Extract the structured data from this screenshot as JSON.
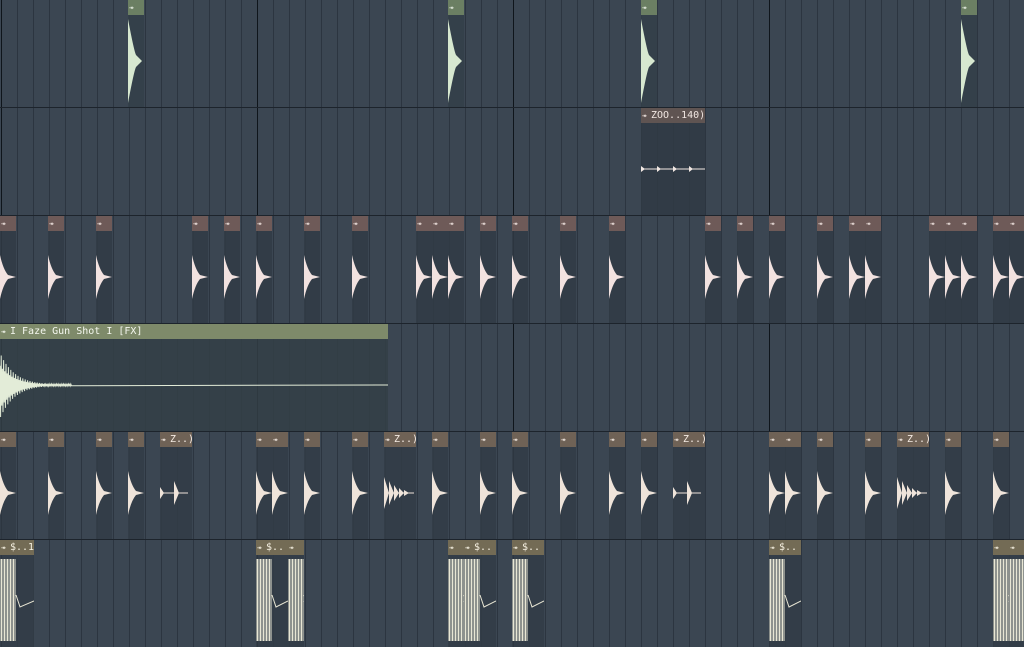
{
  "playlist": {
    "theme": {
      "background": "#3b4652",
      "bar_line": "#0f151b",
      "beat_line": "#2c3540"
    },
    "tracks": [
      {
        "name_visible": "",
        "header_color": "#6b7f63",
        "header_text": "#e8efe4",
        "body_color": "#343f49",
        "wave_color": "#d7e8d0",
        "clips": [
          {
            "start": 128,
            "width": 16,
            "label": "",
            "wave": "spike"
          },
          {
            "start": 448,
            "width": 16,
            "label": "",
            "wave": "spike"
          },
          {
            "start": 641,
            "width": 16,
            "label": "",
            "wave": "spike"
          },
          {
            "start": 961,
            "width": 16,
            "label": "",
            "wave": "spike"
          }
        ]
      },
      {
        "header_color": "#5f5452",
        "header_text": "#f0e6e2",
        "body_color": "#303a44",
        "wave_color": "#f3e9e4",
        "clips": [
          {
            "start": 641,
            "width": 64,
            "label": "ZOO..140)",
            "wave": "taps"
          }
        ]
      },
      {
        "header_color": "#6e5a58",
        "header_text": "#f1e5e1",
        "body_color": "#313b45",
        "wave_color": "#f2e2e0",
        "clips": [
          {
            "start": 0,
            "width": 16,
            "label": ""
          },
          {
            "start": 48,
            "width": 16,
            "label": ""
          },
          {
            "start": 96,
            "width": 16,
            "label": ""
          },
          {
            "start": 192,
            "width": 16,
            "label": ""
          },
          {
            "start": 224,
            "width": 16,
            "label": ""
          },
          {
            "start": 256,
            "width": 16,
            "label": ""
          },
          {
            "start": 304,
            "width": 16,
            "label": ""
          },
          {
            "start": 352,
            "width": 16,
            "label": ""
          },
          {
            "start": 416,
            "width": 16,
            "label": ""
          },
          {
            "start": 432,
            "width": 16,
            "label": ""
          },
          {
            "start": 448,
            "width": 16,
            "label": ""
          },
          {
            "start": 480,
            "width": 16,
            "label": ""
          },
          {
            "start": 512,
            "width": 16,
            "label": ""
          },
          {
            "start": 560,
            "width": 16,
            "label": ""
          },
          {
            "start": 609,
            "width": 16,
            "label": ""
          },
          {
            "start": 705,
            "width": 16,
            "label": ""
          },
          {
            "start": 737,
            "width": 16,
            "label": ""
          },
          {
            "start": 769,
            "width": 16,
            "label": ""
          },
          {
            "start": 817,
            "width": 16,
            "label": ""
          },
          {
            "start": 849,
            "width": 16,
            "label": ""
          },
          {
            "start": 865,
            "width": 16,
            "label": ""
          },
          {
            "start": 929,
            "width": 16,
            "label": ""
          },
          {
            "start": 945,
            "width": 16,
            "label": ""
          },
          {
            "start": 961,
            "width": 16,
            "label": ""
          },
          {
            "start": 993,
            "width": 16,
            "label": ""
          },
          {
            "start": 1009,
            "width": 16,
            "label": ""
          }
        ]
      },
      {
        "header_color": "#7e8a6a",
        "header_text": "#f4f7ee",
        "body_color": "#343f47",
        "wave_color": "#e3ecd8",
        "clips": [
          {
            "start": 0,
            "width": 388,
            "label": "I Faze Gun Shot I [FX]",
            "wave": "long"
          }
        ]
      },
      {
        "header_color": "#6f6256",
        "header_text": "#f5ebe3",
        "body_color": "#323c46",
        "wave_color": "#efe4da",
        "clips": [
          {
            "start": 0,
            "width": 16,
            "label": ""
          },
          {
            "start": 48,
            "width": 16,
            "label": ""
          },
          {
            "start": 96,
            "width": 16,
            "label": ""
          },
          {
            "start": 128,
            "width": 16,
            "label": ""
          },
          {
            "start": 160,
            "width": 32,
            "label": "Z..)",
            "wave": "double"
          },
          {
            "start": 256,
            "width": 16,
            "label": ""
          },
          {
            "start": 272,
            "width": 16,
            "label": ""
          },
          {
            "start": 304,
            "width": 16,
            "label": ""
          },
          {
            "start": 352,
            "width": 16,
            "label": ""
          },
          {
            "start": 384,
            "width": 32,
            "label": "Z..)",
            "wave": "burst"
          },
          {
            "start": 432,
            "width": 16,
            "label": ""
          },
          {
            "start": 480,
            "width": 16,
            "label": ""
          },
          {
            "start": 512,
            "width": 16,
            "label": ""
          },
          {
            "start": 560,
            "width": 16,
            "label": ""
          },
          {
            "start": 609,
            "width": 16,
            "label": ""
          },
          {
            "start": 641,
            "width": 16,
            "label": ""
          },
          {
            "start": 673,
            "width": 32,
            "label": "Z..)",
            "wave": "double"
          },
          {
            "start": 769,
            "width": 16,
            "label": ""
          },
          {
            "start": 785,
            "width": 16,
            "label": ""
          },
          {
            "start": 817,
            "width": 16,
            "label": ""
          },
          {
            "start": 865,
            "width": 16,
            "label": ""
          },
          {
            "start": 897,
            "width": 32,
            "label": "Z..)",
            "wave": "burst"
          },
          {
            "start": 945,
            "width": 16,
            "label": ""
          },
          {
            "start": 993,
            "width": 16,
            "label": ""
          }
        ]
      },
      {
        "header_color": "#736b55",
        "header_text": "#f6f1e2",
        "body_color": "#323c46",
        "wave_color": "#e8e6d4",
        "clips": [
          {
            "start": 0,
            "width": 34,
            "label": "$..1",
            "wave": "dense"
          },
          {
            "start": 256,
            "width": 32,
            "label": "$..",
            "wave": "dense"
          },
          {
            "start": 288,
            "width": 16,
            "label": "",
            "wave": "dense"
          },
          {
            "start": 448,
            "width": 16,
            "label": "",
            "wave": "dense"
          },
          {
            "start": 464,
            "width": 32,
            "label": "$..",
            "wave": "dense"
          },
          {
            "start": 512,
            "width": 32,
            "label": "$..",
            "wave": "dense"
          },
          {
            "start": 769,
            "width": 32,
            "label": "$..",
            "wave": "dense"
          },
          {
            "start": 993,
            "width": 16,
            "label": "",
            "wave": "dense"
          },
          {
            "start": 1009,
            "width": 16,
            "label": "",
            "wave": "dense"
          }
        ]
      }
    ]
  }
}
